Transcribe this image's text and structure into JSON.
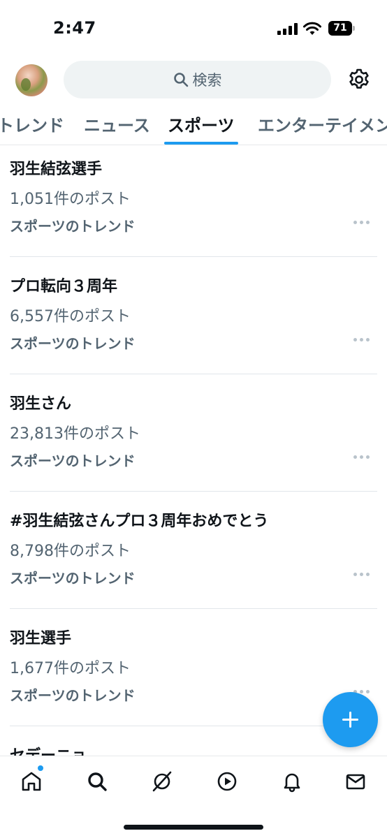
{
  "status_bar": {
    "time": "2:47",
    "battery": "71"
  },
  "header": {
    "search_placeholder": "検索",
    "icons": {
      "search": "search-icon",
      "settings": "gear-icon",
      "avatar": "user-avatar"
    }
  },
  "tabs": [
    {
      "label": "トレンド",
      "active": false
    },
    {
      "label": "ニュース",
      "active": false
    },
    {
      "label": "スポーツ",
      "active": true
    },
    {
      "label": "エンターテイメント",
      "active": false
    }
  ],
  "trends": [
    {
      "title": "羽生結弦選手",
      "count": "1,051件のポスト",
      "category": "スポーツのトレンド"
    },
    {
      "title": "プロ転向３周年",
      "count": "6,557件のポスト",
      "category": "スポーツのトレンド"
    },
    {
      "title": "羽生さん",
      "count": "23,813件のポスト",
      "category": "スポーツのトレンド"
    },
    {
      "title": "#羽生結弦さんプロ３周年おめでとう",
      "count": "8,798件のポスト",
      "category": "スポーツのトレンド"
    },
    {
      "title": "羽生選手",
      "count": "1,677件のポスト",
      "category": "スポーツのトレンド"
    },
    {
      "title": "セデーニョ",
      "count": "",
      "category": ""
    }
  ],
  "colors": {
    "accent": "#1d9bf0",
    "text": "#0f1419",
    "secondary": "#536471"
  },
  "bottom_nav": [
    "home-icon",
    "search-icon",
    "grok-icon",
    "video-icon",
    "bell-icon",
    "mail-icon"
  ]
}
